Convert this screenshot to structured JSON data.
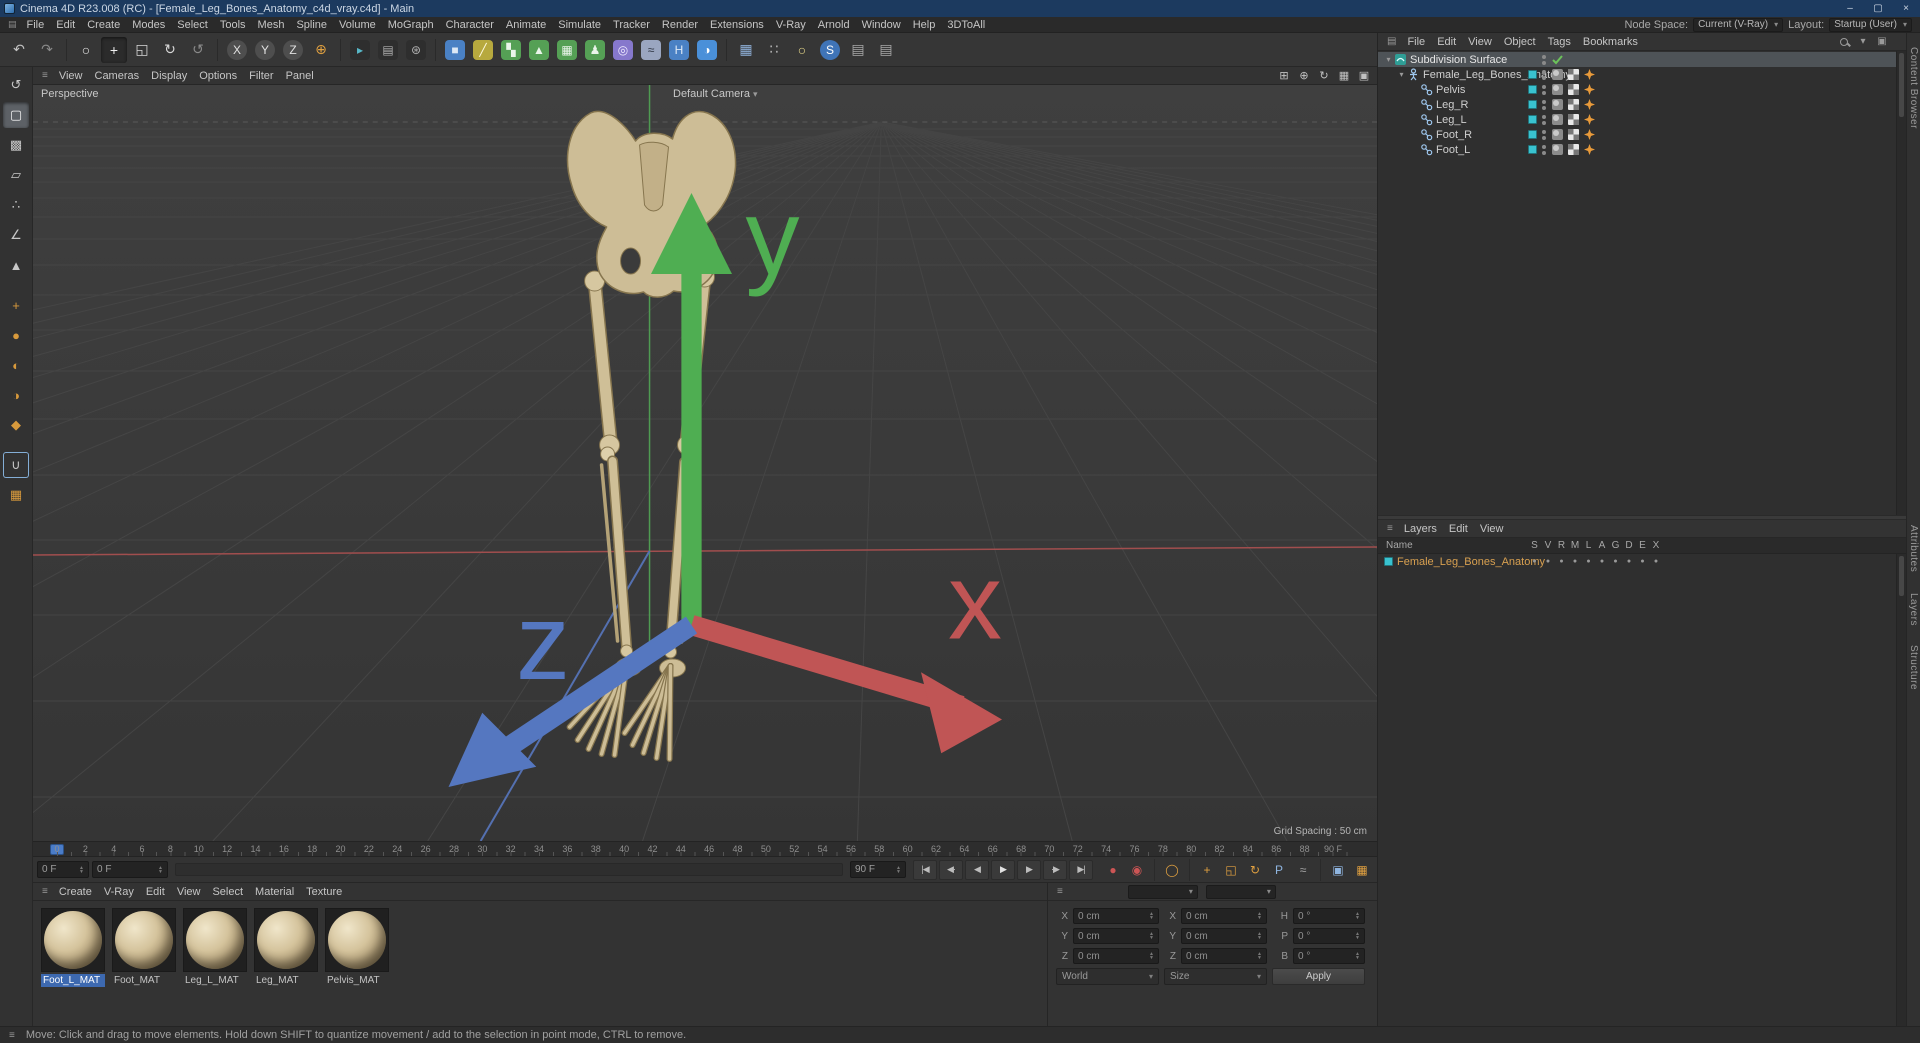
{
  "titlebar": {
    "title": "Cinema 4D R23.008 (RC) - [Female_Leg_Bones_Anatomy_c4d_vray.c4d] - Main",
    "minimize": "–",
    "maximize": "▢",
    "close": "×"
  },
  "menubar": {
    "items": [
      "File",
      "Edit",
      "Create",
      "Modes",
      "Select",
      "Tools",
      "Mesh",
      "Spline",
      "Volume",
      "MoGraph",
      "Character",
      "Animate",
      "Simulate",
      "Tracker",
      "Render",
      "Extensions",
      "V-Ray",
      "Arnold",
      "Window",
      "Help",
      "3DToAll"
    ],
    "node_space_label": "Node Space:",
    "node_space_value": "Current (V-Ray)",
    "layout_label": "Layout:",
    "layout_value": "Startup (User)"
  },
  "toolbar": [
    {
      "name": "undo-icon",
      "glyph": "↶",
      "fg": "#c2c2c2"
    },
    {
      "name": "redo-icon",
      "glyph": "↷",
      "fg": "#8a8a8a"
    },
    {
      "name": "sep"
    },
    {
      "name": "live-selection-icon",
      "glyph": "○",
      "fg": "#e8e8e8"
    },
    {
      "name": "move-tool-icon",
      "glyph": "+",
      "fg": "#f0f0f0",
      "active": true
    },
    {
      "name": "scale-tool-icon",
      "glyph": "◱",
      "fg": "#d8d8d8"
    },
    {
      "name": "rotate-tool-icon",
      "glyph": "↻",
      "fg": "#d8d8d8"
    },
    {
      "name": "last-tool-icon",
      "glyph": "↺",
      "fg": "#8a8a8a"
    },
    {
      "name": "sep"
    },
    {
      "name": "lock-x-axis-icon",
      "glyph": "X",
      "fg": "#e0e0e0",
      "bg": "#4e4e4e",
      "round": true
    },
    {
      "name": "lock-y-axis-icon",
      "glyph": "Y",
      "fg": "#e0e0e0",
      "bg": "#4e4e4e",
      "round": true
    },
    {
      "name": "lock-z-axis-icon",
      "glyph": "Z",
      "fg": "#e0e0e0",
      "bg": "#4e4e4e",
      "round": true
    },
    {
      "name": "coordinate-system-icon",
      "glyph": "⊕",
      "fg": "#e0a040"
    },
    {
      "name": "sep"
    },
    {
      "name": "render-view-icon",
      "glyph": "▸",
      "fg": "#58b8c8",
      "bg": "#2e2e2e"
    },
    {
      "name": "render-picture-viewer-icon",
      "glyph": "▤",
      "fg": "#b0b0b0",
      "bg": "#2e2e2e"
    },
    {
      "name": "render-settings-icon",
      "glyph": "⊛",
      "fg": "#b0b0b0",
      "bg": "#2e2e2e"
    },
    {
      "name": "sep"
    },
    {
      "name": "add-cube-icon",
      "glyph": "■",
      "fg": "#dce8f5",
      "bg": "#4a81c4"
    },
    {
      "name": "pen-tool-icon",
      "glyph": "╱",
      "fg": "#fffbe0",
      "bg": "#b7a93e"
    },
    {
      "name": "mograph-icon",
      "glyph": "▚",
      "fg": "#eaf5ea",
      "bg": "#55a055"
    },
    {
      "name": "fracture-icon",
      "glyph": "▲",
      "fg": "#eaf5ea",
      "bg": "#55a055"
    },
    {
      "name": "volume-icon",
      "glyph": "▦",
      "fg": "#eaf5ea",
      "bg": "#55a055"
    },
    {
      "name": "character-icon",
      "glyph": "♟",
      "fg": "#eaf5ea",
      "bg": "#55a055"
    },
    {
      "name": "simulate-icon",
      "glyph": "◎",
      "fg": "#efeaff",
      "bg": "#8678cc"
    },
    {
      "name": "hair-icon",
      "glyph": "≈",
      "fg": "#2d3440",
      "bg": "#9aa6c0"
    },
    {
      "name": "spline-helper-icon",
      "glyph": "H",
      "fg": "#dce8f5",
      "bg": "#4a81c4"
    },
    {
      "name": "field-icon",
      "glyph": "◑",
      "fg": "#ffffff",
      "bg": "#4a90d9"
    },
    {
      "name": "sep"
    },
    {
      "name": "array-grid-icon",
      "glyph": "▦",
      "fg": "#8fb0d8"
    },
    {
      "name": "snap-dots-icon",
      "glyph": "∷",
      "fg": "#b8b8b8"
    },
    {
      "name": "light-icon",
      "glyph": "○",
      "fg": "#e8d98a"
    },
    {
      "name": "scene-nodes-icon",
      "glyph": "S",
      "fg": "#ffffff",
      "bg": "#3f74b8",
      "round": true
    },
    {
      "name": "team-render-icon",
      "glyph": "▤",
      "fg": "#a8a8a8"
    },
    {
      "name": "export-icon",
      "glyph": "▤",
      "fg": "#a8a8a8"
    }
  ],
  "palette": [
    {
      "name": "make-editable-icon",
      "glyph": "↺",
      "fg": "#c8c8c8"
    },
    {
      "name": "model-mode-icon",
      "glyph": "▢",
      "fg": "#f0f0f0",
      "active": true
    },
    {
      "name": "texture-mode-icon",
      "glyph": "▩",
      "fg": "#c8c8c8"
    },
    {
      "name": "workplane-mode-icon",
      "glyph": "▱",
      "fg": "#c8c8c8"
    },
    {
      "name": "points-mode-icon",
      "glyph": "∴",
      "fg": "#c8c8c8"
    },
    {
      "name": "edges-mode-icon",
      "glyph": "∠",
      "fg": "#c8c8c8"
    },
    {
      "name": "polygons-mode-icon",
      "glyph": "▲",
      "fg": "#c8c8c8"
    },
    {
      "name": "gap"
    },
    {
      "name": "enable-axis-icon",
      "glyph": "+",
      "fg": "#d89a3c"
    },
    {
      "name": "viewport-solo-off-icon",
      "glyph": "●",
      "fg": "#d89a3c"
    },
    {
      "name": "viewport-solo-single-icon",
      "glyph": "◐",
      "fg": "#d89a3c"
    },
    {
      "name": "viewport-solo-hierarchy-icon",
      "glyph": "◑",
      "fg": "#d89a3c"
    },
    {
      "name": "paint-icon",
      "glyph": "◆",
      "fg": "#d89a3c"
    },
    {
      "name": "gap"
    },
    {
      "name": "enable-snap-icon",
      "glyph": "∪",
      "fg": "#c8c8c8",
      "framed": true
    },
    {
      "name": "workplane-snap-icon",
      "glyph": "▦",
      "fg": "#d89a3c"
    }
  ],
  "viewport": {
    "menus": [
      "View",
      "Cameras",
      "Display",
      "Options",
      "Filter",
      "Panel"
    ],
    "corner_icons": [
      {
        "name": "pan-view-icon",
        "glyph": "⊞"
      },
      {
        "name": "zoom-view-icon",
        "glyph": "⊕"
      },
      {
        "name": "rotate-view-icon",
        "glyph": "↻"
      },
      {
        "name": "toggle-views-icon",
        "glyph": "▦"
      },
      {
        "name": "single-view-icon",
        "glyph": "▣"
      }
    ],
    "projection": "Perspective",
    "camera": "Default Camera",
    "grid_label": "Grid Spacing : 50 cm",
    "axis_labels": {
      "x": "x",
      "y": "y",
      "z": "z"
    }
  },
  "timeline": {
    "ticks": [
      "0",
      "2",
      "4",
      "6",
      "8",
      "10",
      "12",
      "14",
      "16",
      "18",
      "20",
      "22",
      "24",
      "26",
      "28",
      "30",
      "32",
      "34",
      "36",
      "38",
      "40",
      "42",
      "44",
      "46",
      "48",
      "50",
      "52",
      "54",
      "56",
      "58",
      "60",
      "62",
      "64",
      "66",
      "68",
      "70",
      "72",
      "74",
      "76",
      "78",
      "80",
      "82",
      "84",
      "86",
      "88",
      "90 F"
    ]
  },
  "transport": {
    "start": "0 F",
    "current": "0 F",
    "end": "90 F",
    "buttons": [
      {
        "name": "goto-start-button",
        "glyph": "|◀"
      },
      {
        "name": "prev-key-button",
        "glyph": "◀·"
      },
      {
        "name": "prev-frame-button",
        "glyph": "◀"
      },
      {
        "name": "play-button",
        "glyph": "▶",
        "accent": true
      },
      {
        "name": "next-frame-button",
        "glyph": "▶"
      },
      {
        "name": "next-key-button",
        "glyph": "·▶"
      },
      {
        "name": "goto-end-button",
        "glyph": "▶|"
      }
    ],
    "rec_icons": [
      {
        "name": "record-keyframe-icon",
        "glyph": "●",
        "fg": "#cc5555"
      },
      {
        "name": "record-objects-icon",
        "glyph": "◉",
        "fg": "#cc5555"
      },
      {
        "name": "sep"
      },
      {
        "name": "autokeying-icon",
        "glyph": "◯",
        "fg": "#e0a040"
      },
      {
        "name": "sep"
      },
      {
        "name": "key-position-icon",
        "glyph": "+",
        "fg": "#e0a040"
      },
      {
        "name": "key-scale-icon",
        "glyph": "◱",
        "fg": "#e0a040"
      },
      {
        "name": "key-rotation-icon",
        "glyph": "↻",
        "fg": "#e0a040"
      },
      {
        "name": "key-parameter-icon",
        "glyph": "P",
        "fg": "#8fb5e0"
      },
      {
        "name": "key-pla-icon",
        "glyph": "≈",
        "fg": "#a8a8a8"
      },
      {
        "name": "sep"
      },
      {
        "name": "playback-solo-icon",
        "glyph": "▣",
        "fg": "#8fb5e0"
      },
      {
        "name": "minimal-ui-icon",
        "glyph": "▦",
        "fg": "#e0a040"
      }
    ]
  },
  "materials": {
    "menus": [
      "Create",
      "V-Ray",
      "Edit",
      "View",
      "Select",
      "Material",
      "Texture"
    ],
    "items": [
      {
        "label": "Foot_L_MAT",
        "selected": true
      },
      {
        "label": "Foot_MAT",
        "selected": false
      },
      {
        "label": "Leg_L_MAT",
        "selected": false
      },
      {
        "label": "Leg_MAT",
        "selected": false
      },
      {
        "label": "Pelvis_MAT",
        "selected": false
      }
    ]
  },
  "coordinates": {
    "groups": [
      {
        "rows": [
          {
            "label": "X",
            "value": "0 cm"
          },
          {
            "label": "Y",
            "value": "0 cm"
          },
          {
            "label": "Z",
            "value": "0 cm"
          }
        ],
        "footer": {
          "type": "dropdown",
          "value": "World"
        }
      },
      {
        "rows": [
          {
            "label": "X",
            "value": "0 cm"
          },
          {
            "label": "Y",
            "value": "0 cm"
          },
          {
            "label": "Z",
            "value": "0 cm"
          }
        ],
        "footer": {
          "type": "dropdown",
          "value": "Size"
        }
      },
      {
        "rows": [
          {
            "label": "H",
            "value": "0 °"
          },
          {
            "label": "P",
            "value": "0 °"
          },
          {
            "label": "B",
            "value": "0 °"
          }
        ],
        "footer": {
          "type": "button",
          "value": "Apply"
        }
      }
    ]
  },
  "object_manager": {
    "menus": [
      "File",
      "Edit",
      "View",
      "Object",
      "Tags",
      "Bookmarks"
    ],
    "tree": [
      {
        "name": "Subdivision Surface",
        "level": 0,
        "icon": "sds",
        "expand": "▾",
        "selected": true,
        "chip": "",
        "tags": [
          "check"
        ]
      },
      {
        "name": "Female_Leg_Bones_Anatomy",
        "level": 1,
        "icon": "figure",
        "expand": "▾",
        "chip": "#39c2cf",
        "tags": [
          "phong",
          "texture",
          "star"
        ]
      },
      {
        "name": "Pelvis",
        "level": 2,
        "icon": "joint",
        "expand": "",
        "chip": "#39c2cf",
        "tags": [
          "phong",
          "texture",
          "star"
        ]
      },
      {
        "name": "Leg_R",
        "level": 2,
        "icon": "joint",
        "expand": "",
        "chip": "#39c2cf",
        "tags": [
          "phong",
          "texture",
          "star"
        ]
      },
      {
        "name": "Leg_L",
        "level": 2,
        "icon": "joint",
        "expand": "",
        "chip": "#39c2cf",
        "tags": [
          "phong",
          "texture",
          "star"
        ]
      },
      {
        "name": "Foot_R",
        "level": 2,
        "icon": "joint",
        "expand": "",
        "chip": "#39c2cf",
        "tags": [
          "phong",
          "texture",
          "star"
        ]
      },
      {
        "name": "Foot_L",
        "level": 2,
        "icon": "joint",
        "expand": "",
        "chip": "#39c2cf",
        "tags": [
          "phong",
          "texture",
          "star"
        ]
      }
    ]
  },
  "layers_panel": {
    "menus": [
      "Layers",
      "Edit",
      "View"
    ],
    "name_header": "Name",
    "columns": [
      "S",
      "V",
      "R",
      "M",
      "L",
      "A",
      "G",
      "D",
      "E",
      "X"
    ],
    "rows": [
      {
        "name": "Female_Leg_Bones_Anatomy",
        "chip": "#39c2cf"
      }
    ]
  },
  "right_tabs": [
    "Content Browser",
    "Attributes",
    "Layers",
    "Structure"
  ],
  "statusbar": {
    "text": "Move: Click and drag to move elements. Hold down SHIFT to quantize movement / add to the selection in point mode, CTRL to remove."
  }
}
